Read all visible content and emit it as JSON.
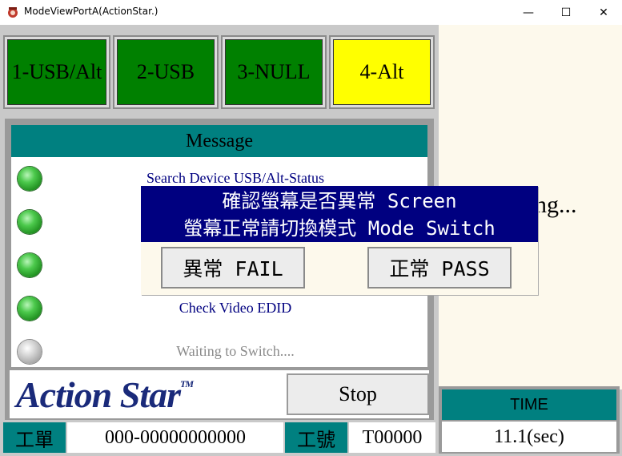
{
  "window": {
    "title": "ModeViewPortA(ActionStar.)",
    "minimize_glyph": "—",
    "maximize_glyph": "☐",
    "close_glyph": "✕"
  },
  "modes": [
    {
      "label": "1-USB/Alt",
      "color": "#008000"
    },
    {
      "label": "2-USB",
      "color": "#008000"
    },
    {
      "label": "3-NULL",
      "color": "#008000"
    },
    {
      "label": "4-Alt",
      "color": "#ffff00"
    }
  ],
  "message_panel": {
    "header": "Message",
    "steps": [
      {
        "text": "Search Device USB/Alt-Status",
        "led": "green",
        "text_color": "#000080"
      },
      {
        "text": "",
        "led": "green",
        "text_color": "#000080"
      },
      {
        "text": "",
        "led": "green",
        "text_color": "#000080"
      },
      {
        "text": "Check Video EDID",
        "led": "green",
        "text_color": "#000080"
      },
      {
        "text": "Waiting to Switch....",
        "led": "gray",
        "text_color": "#8a8a8a"
      }
    ]
  },
  "logo": {
    "text": "Action Star",
    "tm": "TM",
    "color": "#1a2a7a"
  },
  "stop_label": "Stop",
  "right_panel": {
    "status_text": "ng..."
  },
  "time": {
    "label": "TIME",
    "value": "11.1(sec)"
  },
  "status_bar": {
    "order_label": "工單",
    "order_value": "000-00000000000",
    "serial_label": "工號",
    "serial_value": "T00000"
  },
  "dialog": {
    "line1": "確認螢幕是否異常 Screen",
    "line2": "螢幕正常請切換模式 Mode Switch",
    "fail_label": "異常 FAIL",
    "pass_label": "正常 PASS"
  },
  "colors": {
    "teal": "#008080",
    "navy": "#000080",
    "mode_green": "#008000",
    "mode_yellow": "#ffff00"
  },
  "icons": [
    "app-icon",
    "minimize-icon",
    "maximize-icon",
    "close-icon",
    "status-led-icon"
  ]
}
